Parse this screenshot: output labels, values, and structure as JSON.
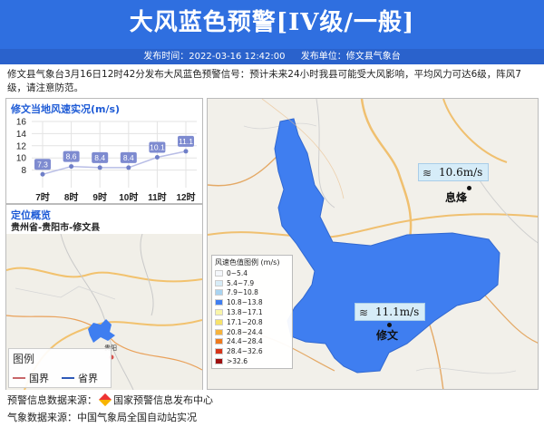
{
  "header": {
    "title": "大风蓝色预警[IV级/一般]",
    "publish_time": "发布时间：2022-03-16 12:42:00",
    "publish_unit": "发布单位：修文县气象台"
  },
  "summary": "修文县气象台3月16日12时42分发布大风蓝色预警信号：预计未来24小时我县可能受大风影响，平均风力可达6级，阵风7级，请注意防范。",
  "wind_panel": {
    "title": "修文当地风速实况(m/s)"
  },
  "chart_data": {
    "type": "line",
    "title": "修文当地风速实况(m/s)",
    "categories": [
      "7时",
      "8时",
      "9时",
      "10时",
      "11时",
      "12时"
    ],
    "series": [
      {
        "values": [
          7.3,
          8.6,
          8.4,
          8.4,
          10.1,
          11.1
        ]
      }
    ],
    "ylim": [
      6,
      16
    ],
    "yticks": [
      8,
      10,
      12,
      14,
      16
    ],
    "grid": true,
    "color": "#6f7fc8",
    "label_bg": "#7e8bd0"
  },
  "overview": {
    "title": "定位概览",
    "subtitle": "贵州省-贵阳市-修文县",
    "city_label": "贵阳",
    "legend_title": "图例",
    "legend_items": [
      {
        "label": "国界",
        "color": "#c8676a"
      },
      {
        "label": "省界",
        "color": "#2f5ab8"
      }
    ]
  },
  "map": {
    "fill_color": "#3f7ef0",
    "stations": [
      {
        "name": "息烽",
        "wind": "10.6m/s"
      },
      {
        "name": "修文",
        "wind": "11.1m/s"
      }
    ],
    "legend_title": "风速色值图例 (m/s)",
    "legend": [
      {
        "label": "0~5.4",
        "color": "#f4f7fb"
      },
      {
        "label": "5.4~7.9",
        "color": "#d7ecf7"
      },
      {
        "label": "7.9~10.8",
        "color": "#a9d4f1"
      },
      {
        "label": "10.8~13.8",
        "color": "#3f7ef0"
      },
      {
        "label": "13.8~17.1",
        "color": "#f9f5a8"
      },
      {
        "label": "17.1~20.8",
        "color": "#f7e26a"
      },
      {
        "label": "20.8~24.4",
        "color": "#f6b33c"
      },
      {
        "label": "24.4~28.4",
        "color": "#ee7a1e"
      },
      {
        "label": "28.4~32.6",
        "color": "#d6361a"
      },
      {
        "label": ">32.6",
        "color": "#9e1010"
      }
    ]
  },
  "footer": {
    "warning_source_label": "预警信息数据来源：",
    "warning_source": "国家预警信息发布中心",
    "weather_source": "气象数据来源：中国气象局全国自动站实况"
  }
}
